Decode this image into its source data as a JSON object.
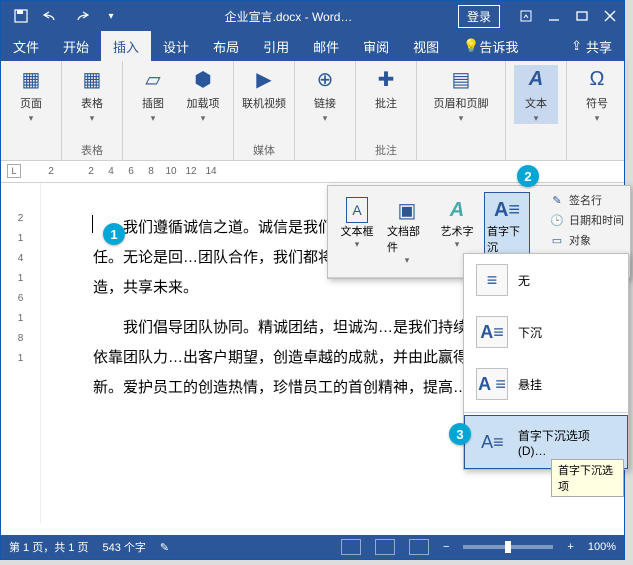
{
  "titlebar": {
    "filename": "企业宣言.docx",
    "app": "Word…",
    "login": "登录"
  },
  "tabs": {
    "items": [
      "文件",
      "开始",
      "插入",
      "设计",
      "布局",
      "引用",
      "邮件",
      "审阅",
      "视图"
    ],
    "active_index": 2,
    "tell_me": "告诉我",
    "share": "共享"
  },
  "ribbon": {
    "groups": [
      {
        "label": "",
        "items": [
          {
            "label": "页面"
          }
        ]
      },
      {
        "label": "表格",
        "items": [
          {
            "label": "表格"
          }
        ]
      },
      {
        "label": "",
        "items": [
          {
            "label": "插图"
          },
          {
            "label": "加载项"
          }
        ]
      },
      {
        "label": "媒体",
        "items": [
          {
            "label": "联机视频"
          }
        ]
      },
      {
        "label": "",
        "items": [
          {
            "label": "链接"
          }
        ]
      },
      {
        "label": "批注",
        "items": [
          {
            "label": "批注"
          }
        ]
      },
      {
        "label": "",
        "items": [
          {
            "label": "页眉和页脚"
          }
        ]
      },
      {
        "label": "",
        "items": [
          {
            "label": "文本",
            "selected": true
          }
        ]
      },
      {
        "label": "",
        "items": [
          {
            "label": "符号"
          }
        ]
      }
    ]
  },
  "ruler": {
    "ticks": [
      "2",
      "",
      "2",
      "4",
      "6",
      "8",
      "10",
      "12",
      "14"
    ]
  },
  "vruler": {
    "ticks": [
      "",
      "2",
      "1",
      "4",
      "1",
      "6",
      "1",
      "8",
      "1"
    ]
  },
  "document": {
    "para1": "我们遵循诚信之道。诚信是我们事业的…真诚赢得忠诚，以信誉赢得信任。无论是回…团队合作，我们都将恪守诚信之道，并努力…朋友共同创造，共享未来。",
    "para2": "我们倡导团队协同。精诚团结，坦诚沟…是我们持续发展的根本。我们依靠团队力…出客户期望，创造卓越的成就，并由此赢得世人的尊…习创新。爱护员工的创造热情，珍惜员工的首创精神，提高…"
  },
  "text_flyout": {
    "items": [
      {
        "label": "文本框"
      },
      {
        "label": "文档部件"
      },
      {
        "label": "艺术字"
      },
      {
        "label": "首字下沉",
        "selected": true
      }
    ],
    "side": [
      {
        "label": "签名行"
      },
      {
        "label": "日期和时间"
      },
      {
        "label": "对象"
      }
    ]
  },
  "dropcap_menu": {
    "options": [
      {
        "label": "无"
      },
      {
        "label": "下沉"
      },
      {
        "label": "悬挂"
      }
    ],
    "more": "首字下沉选项(D)…",
    "tooltip": "首字下沉选项"
  },
  "status": {
    "page": "第 1 页，共 1 页",
    "words": "543 个字",
    "zoom": "100%"
  },
  "callouts": {
    "c1": "1",
    "c2": "2",
    "c3": "3"
  }
}
